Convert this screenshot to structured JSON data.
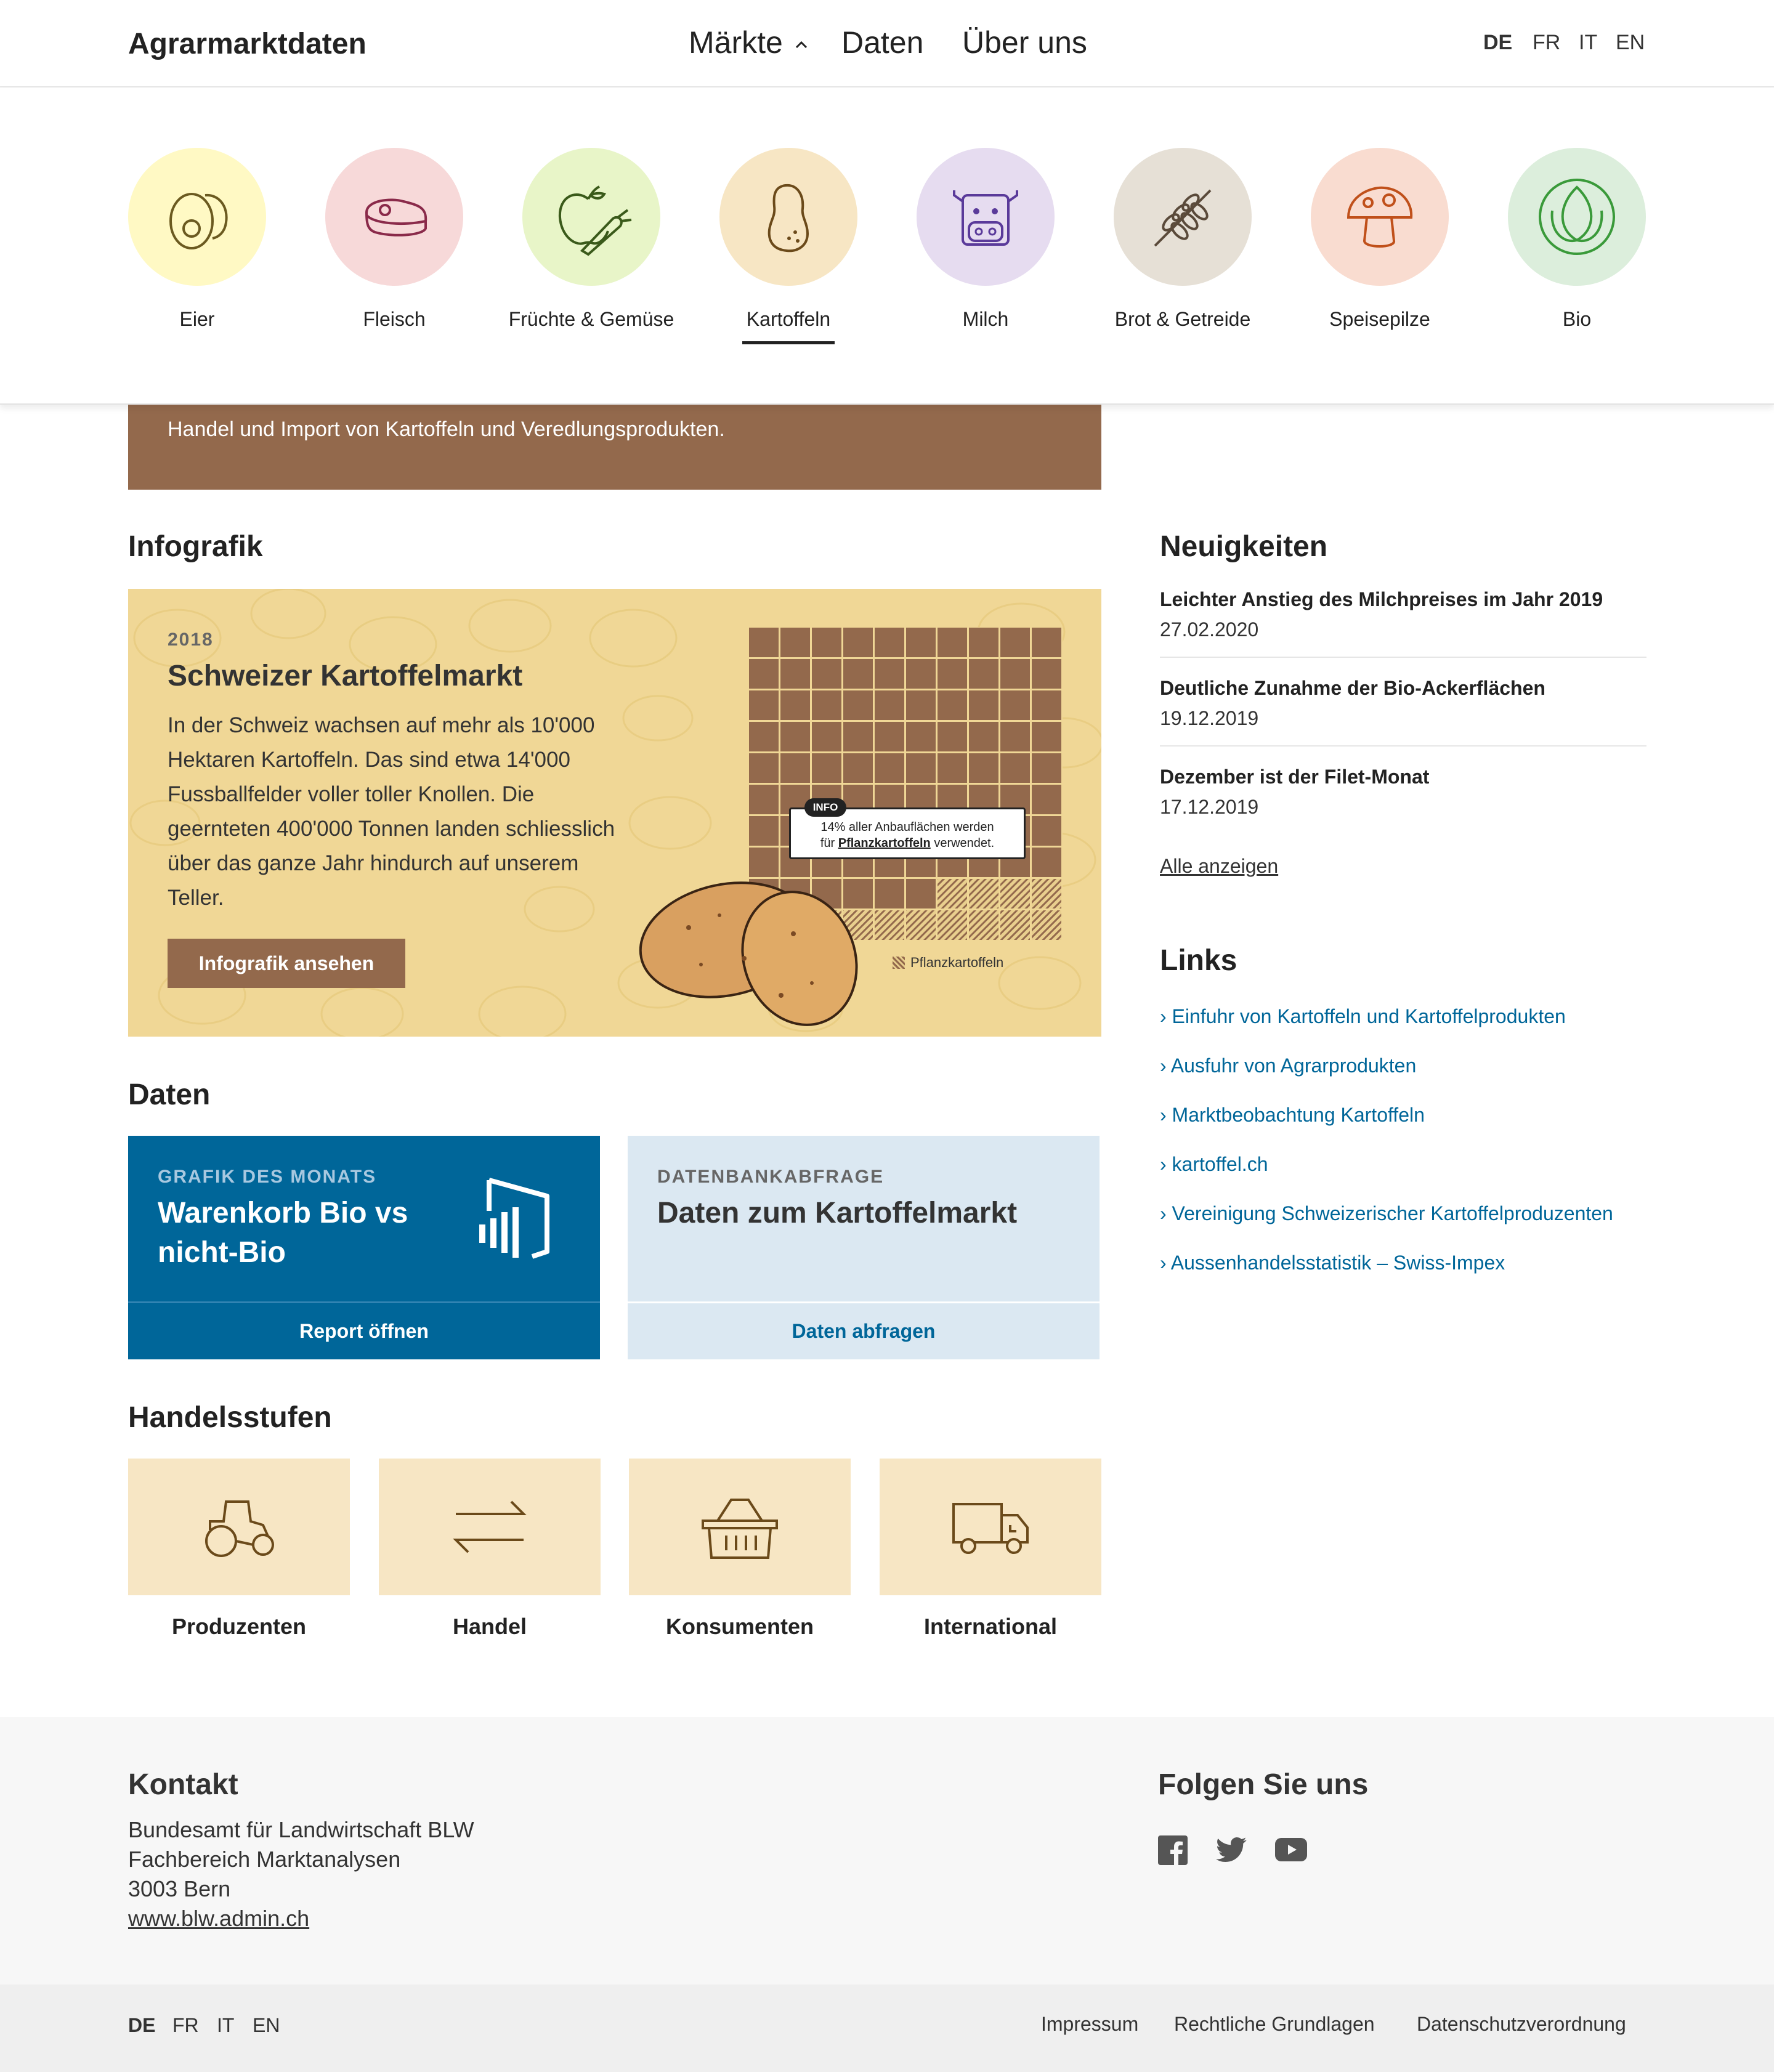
{
  "header": {
    "brand": "Agrarmarktdaten",
    "nav": {
      "markets": "Märkte",
      "data": "Daten",
      "about": "Über uns"
    },
    "languages": [
      "DE",
      "FR",
      "IT",
      "EN"
    ],
    "active_language": "DE"
  },
  "categories": [
    {
      "label": "Eier",
      "color": "#fff9c4",
      "icon": "egg-icon"
    },
    {
      "label": "Fleisch",
      "color": "#f7d9d9",
      "icon": "meat-icon"
    },
    {
      "label": "Früchte & Gemüse",
      "color": "#e8f5c8",
      "icon": "fruit-vegetable-icon"
    },
    {
      "label": "Kartoffeln",
      "color": "#f7e6c4",
      "icon": "potato-icon",
      "active": true
    },
    {
      "label": "Milch",
      "color": "#e6dcf0",
      "icon": "cow-icon"
    },
    {
      "label": "Brot & Getreide",
      "color": "#e6e0d6",
      "icon": "grain-icon"
    },
    {
      "label": "Speisepilze",
      "color": "#f9dcd0",
      "icon": "mushroom-icon"
    },
    {
      "label": "Bio",
      "color": "#dceedc",
      "icon": "bio-leaf-icon"
    }
  ],
  "hero": {
    "text": "Handel und Import von Kartoffeln und Veredlungsprodukten."
  },
  "infografik": {
    "heading": "Infografik",
    "year": "2018",
    "title": "Schweizer Kartoffelmarkt",
    "body": "In der Schweiz wachsen auf mehr als 10'000 Hektaren Kartoffeln. Das sind etwa 14'000 Fussballfelder voller toller Knollen. Die geernteten 400'000 Tonnen landen schliesslich über das ganze Jahr hindurch auf unserem Teller.",
    "button": "Infografik ansehen",
    "callout_badge": "INFO",
    "callout_line1": "14% aller Anbauflächen werden",
    "callout_pre": "für ",
    "callout_bold": "Pflanzkartoffeln",
    "callout_post": " verwendet.",
    "legend": "Pflanzkartoffeln",
    "grid_share_percent": 14
  },
  "daten": {
    "heading": "Daten",
    "card1": {
      "kicker": "GRAFIK DES MONATS",
      "title": "Warenkorb Bio vs nicht-Bio",
      "action": "Report öffnen"
    },
    "card2": {
      "kicker": "DATENBANKABFRAGE",
      "title": "Daten zum Kartoffelmarkt",
      "action": "Daten abfragen"
    }
  },
  "handelsstufen": {
    "heading": "Handelsstufen",
    "items": [
      {
        "label": "Produzenten",
        "icon": "tractor-icon"
      },
      {
        "label": "Handel",
        "icon": "exchange-arrows-icon"
      },
      {
        "label": "Konsumenten",
        "icon": "basket-icon"
      },
      {
        "label": "International",
        "icon": "truck-icon"
      }
    ]
  },
  "neuigkeiten": {
    "heading": "Neuigkeiten",
    "items": [
      {
        "title": "Leichter Anstieg des Milchpreises im Jahr 2019",
        "date": "27.02.2020"
      },
      {
        "title": "Deutliche Zunahme der Bio-Ackerflächen",
        "date": "19.12.2019"
      },
      {
        "title": "Dezember ist der Filet-Monat",
        "date": "17.12.2019"
      }
    ],
    "show_all": "Alle anzeigen"
  },
  "links": {
    "heading": "Links",
    "items": [
      "› Einfuhr von Kartoffeln und Kartoffelprodukten",
      "› Ausfuhr von Agrarprodukten",
      "› Marktbeobachtung Kartoffeln",
      "› kartoffel.ch",
      "› Vereinigung Schweizerischer Kartoffelproduzenten",
      "› Aussenhandelsstatistik – Swiss-Impex"
    ]
  },
  "footer": {
    "contact_heading": "Kontakt",
    "contact_lines": [
      "Bundesamt für Landwirtschaft BLW",
      "Fachbereich Marktanalysen",
      "3003 Bern"
    ],
    "website": "www.blw.admin.ch",
    "follow_heading": "Folgen Sie uns",
    "social": [
      "facebook-icon",
      "twitter-icon",
      "youtube-icon"
    ],
    "languages": [
      "DE",
      "FR",
      "IT",
      "EN"
    ],
    "legal_links": [
      "Impressum",
      "Rechtliche Grundlagen",
      "Datenschutzverordnung"
    ]
  }
}
